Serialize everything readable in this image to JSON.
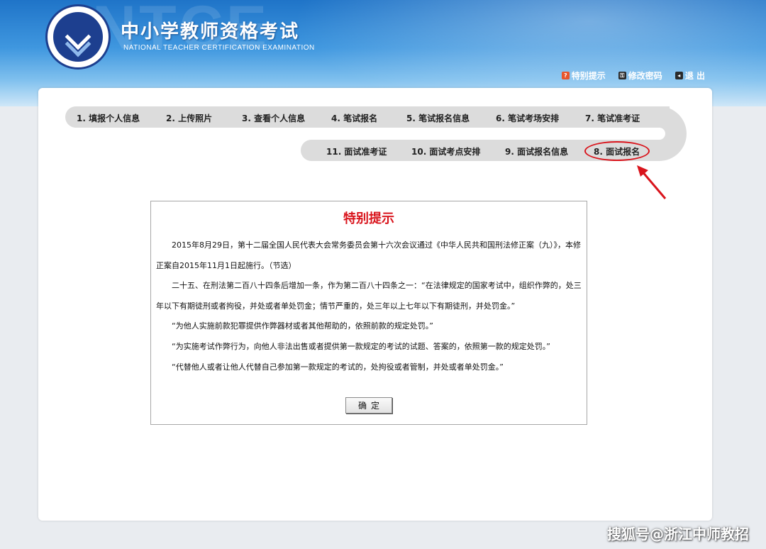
{
  "header": {
    "title": "中小学教师资格考试",
    "subtitle": "NATIONAL TEACHER CERTIFICATION EXAMINATION",
    "links": [
      {
        "label": "特别提示",
        "icon": "help-icon"
      },
      {
        "label": "修改密码",
        "icon": "key-icon"
      },
      {
        "label": "退 出",
        "icon": "exit-icon"
      }
    ]
  },
  "steps_row1": [
    "1. 填报个人信息",
    "2. 上传照片",
    "3. 查看个人信息",
    "4. 笔试报名",
    "5. 笔试报名信息",
    "6. 笔试考场安排",
    "7. 笔试准考证"
  ],
  "steps_row2": [
    "11. 面试准考证",
    "10. 面试考点安排",
    "9. 面试报名信息",
    "8. 面试报名"
  ],
  "notice": {
    "title": "特别提示",
    "paragraphs": [
      "2015年8月29日，第十二届全国人民代表大会常务委员会第十六次会议通过《中华人民共和国刑法修正案（九）》，本修正案自2015年11月1日起施行。（节选）",
      "二十五、在刑法第二百八十四条后增加一条，作为第二百八十四条之一：“在法律规定的国家考试中，组织作弊的，处三年以下有期徒刑或者拘役，并处或者单处罚金；情节严重的，处三年以上七年以下有期徒刑，并处罚金。”",
      "“为他人实施前款犯罪提供作弊器材或者其他帮助的，依照前款的规定处罚。”",
      "“为实施考试作弊行为，向他人非法出售或者提供第一款规定的考试的试题、答案的，依照第一款的规定处罚。”",
      "“代替他人或者让他人代替自己参加第一款规定的考试的，处拘役或者管制，并处或者单处罚金。”"
    ],
    "confirm_label": "确定"
  },
  "watermark": "搜狐号@浙江中师教招",
  "colors": {
    "accent_red": "#d9141c",
    "header_blue": "#1f74c8"
  }
}
